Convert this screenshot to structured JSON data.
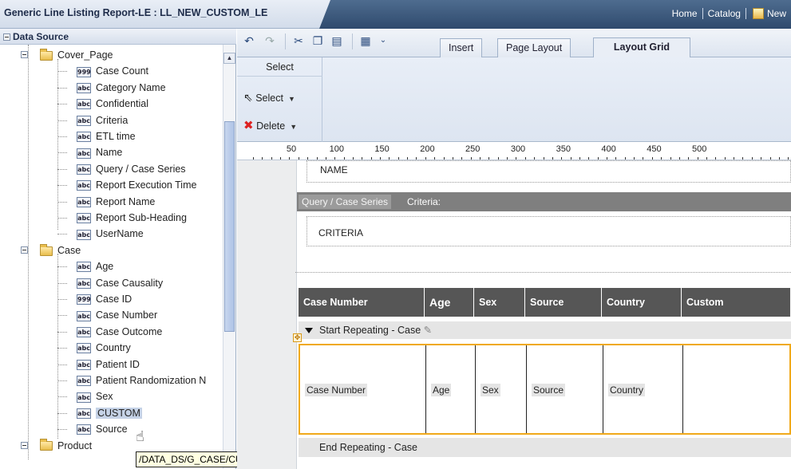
{
  "window": {
    "title": "Generic Line Listing Report-LE : LL_NEW_CUSTOM_LE",
    "links": [
      "Home",
      "Catalog",
      "New"
    ]
  },
  "left_panel": {
    "header": "Data Source",
    "tree": [
      {
        "label": "Cover_Page",
        "kind": "folder",
        "level": 1,
        "expanded": true
      },
      {
        "label": "Case Count",
        "kind": "field",
        "type": "999",
        "level": 2
      },
      {
        "label": "Category Name",
        "kind": "field",
        "type": "abc",
        "level": 2
      },
      {
        "label": "Confidential",
        "kind": "field",
        "type": "abc",
        "level": 2
      },
      {
        "label": "Criteria",
        "kind": "field",
        "type": "abc",
        "level": 2
      },
      {
        "label": "ETL time",
        "kind": "field",
        "type": "abc",
        "level": 2
      },
      {
        "label": "Name",
        "kind": "field",
        "type": "abc",
        "level": 2
      },
      {
        "label": "Query / Case Series",
        "kind": "field",
        "type": "abc",
        "level": 2
      },
      {
        "label": "Report Execution Time",
        "kind": "field",
        "type": "abc",
        "level": 2
      },
      {
        "label": "Report Name",
        "kind": "field",
        "type": "abc",
        "level": 2
      },
      {
        "label": "Report Sub-Heading",
        "kind": "field",
        "type": "abc",
        "level": 2
      },
      {
        "label": "UserName",
        "kind": "field",
        "type": "abc",
        "level": 2
      },
      {
        "label": "Case",
        "kind": "folder",
        "level": 1,
        "expanded": true
      },
      {
        "label": "Age",
        "kind": "field",
        "type": "abc",
        "level": 2
      },
      {
        "label": "Case Causality",
        "kind": "field",
        "type": "abc",
        "level": 2
      },
      {
        "label": "Case ID",
        "kind": "field",
        "type": "999",
        "level": 2
      },
      {
        "label": "Case Number",
        "kind": "field",
        "type": "abc",
        "level": 2
      },
      {
        "label": "Case Outcome",
        "kind": "field",
        "type": "abc",
        "level": 2
      },
      {
        "label": "Country",
        "kind": "field",
        "type": "abc",
        "level": 2
      },
      {
        "label": "Patient ID",
        "kind": "field",
        "type": "abc",
        "level": 2
      },
      {
        "label": "Patient Randomization N",
        "kind": "field",
        "type": "abc",
        "level": 2
      },
      {
        "label": "Sex",
        "kind": "field",
        "type": "abc",
        "level": 2
      },
      {
        "label": "CUSTOM",
        "kind": "field",
        "type": "abc",
        "level": 2,
        "selected": true
      },
      {
        "label": "Source",
        "kind": "field",
        "type": "abc",
        "level": 2
      },
      {
        "label": "Product",
        "kind": "folder",
        "level": 1,
        "expanded": true
      }
    ],
    "tooltip": "/DATA_DS/G_CASE/CUSTOM"
  },
  "toolbar": {
    "tabs": [
      {
        "label": "Insert",
        "active": false
      },
      {
        "label": "Page Layout",
        "active": false
      },
      {
        "label": "Layout Grid",
        "active": true
      }
    ]
  },
  "ribbon": {
    "group_label": "Select",
    "select_label": "Select",
    "delete_label": "Delete"
  },
  "ruler": {
    "labels": [
      "50",
      "100",
      "150",
      "200",
      "250",
      "300",
      "350",
      "400",
      "450",
      "500"
    ]
  },
  "canvas": {
    "name_field": "NAME",
    "query_tag": "Query / Case Series",
    "criteria_label": "Criteria:",
    "criteria_field": "CRITERIA",
    "columns": [
      "Case Number",
      "Age",
      "Sex",
      "Source",
      "Country",
      "Custom"
    ],
    "start_repeating": "Start Repeating - Case",
    "row_values": [
      "Case Number",
      "Age",
      "Sex",
      "Source",
      "Country",
      ""
    ],
    "end_repeating": "End Repeating - Case"
  }
}
